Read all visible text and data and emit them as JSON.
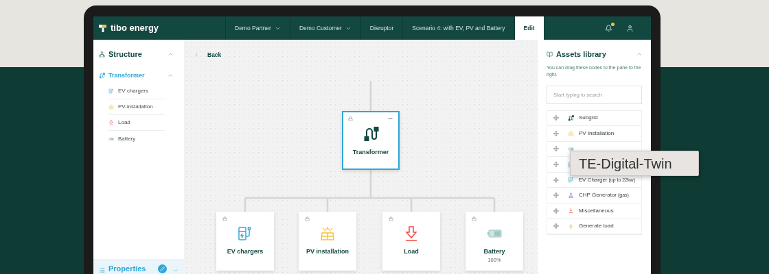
{
  "app": {
    "logo": "tibo energy"
  },
  "nav_tabs": [
    {
      "label": "Demo Partner",
      "dropdown": true,
      "selected": false
    },
    {
      "label": "Demo Customer",
      "dropdown": true,
      "selected": false
    },
    {
      "label": "Disruptor",
      "dropdown": false,
      "selected": false
    },
    {
      "label": "Scenario 4: with EV, PV and Battery",
      "dropdown": false,
      "selected": false
    },
    {
      "label": "Edit",
      "dropdown": false,
      "selected": true
    }
  ],
  "notifications": {
    "unread": true
  },
  "structure": {
    "title": "Structure",
    "expanded": true,
    "tree": [
      {
        "label": "Transformer",
        "kind": "subgrid",
        "selected": true,
        "expanded": true,
        "children": [
          {
            "label": "EV chargers",
            "kind": "ev",
            "selected": false
          },
          {
            "label": "PV-installation",
            "kind": "pv",
            "selected": false
          },
          {
            "label": "Load",
            "kind": "load",
            "selected": false
          },
          {
            "label": "Battery",
            "kind": "battery",
            "selected": false
          }
        ]
      }
    ]
  },
  "properties": {
    "title": "Properties",
    "expanded": false
  },
  "canvas": {
    "back": "Back",
    "root": {
      "label": "Transformer",
      "kind": "subgrid",
      "selected": true
    },
    "nodes": [
      {
        "label": "EV chargers",
        "kind": "ev",
        "selected": false
      },
      {
        "label": "PV installation",
        "kind": "pv",
        "selected": false
      },
      {
        "label": "Load",
        "kind": "load",
        "selected": false
      },
      {
        "label": "Battery",
        "kind": "battery",
        "selected": false,
        "reading": "100%"
      }
    ]
  },
  "assets": {
    "title": "Assets library",
    "expanded": true,
    "hint": "You can drag these nodes to the pane to the right.",
    "search_placeholder": "Start typing to search",
    "items": [
      {
        "label": "Subgrid",
        "kind": "subgrid"
      },
      {
        "label": "PV Installation",
        "kind": "pv"
      },
      {
        "kind": "battery"
      },
      {
        "kind": "ev"
      },
      {
        "label": "EV Charger",
        "note": "(up to 22kw)",
        "kind": "ev"
      },
      {
        "label": "CHP Generator",
        "note": "(gas)",
        "kind": "chp"
      },
      {
        "label": "Miscellaneous",
        "kind": "misc"
      },
      {
        "label": "Generate load",
        "kind": "generate"
      }
    ]
  },
  "tooltip": "TE-Digital-Twin"
}
